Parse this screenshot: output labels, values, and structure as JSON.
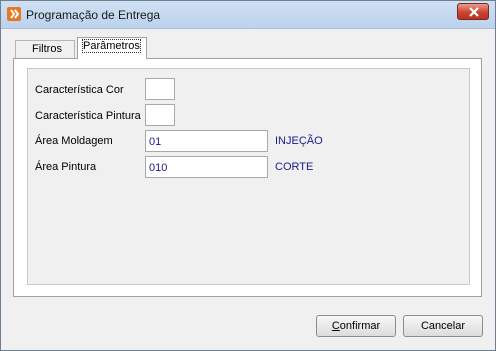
{
  "window": {
    "title": "Programação de Entrega"
  },
  "tabs": [
    {
      "label": "Filtros",
      "active": false
    },
    {
      "label": "Parâmetros",
      "active": true
    }
  ],
  "fields": {
    "caracteristica_cor": {
      "label": "Característica Cor",
      "value": ""
    },
    "caracteristica_pintura": {
      "label": "Característica Pintura",
      "value": ""
    },
    "area_moldagem": {
      "label": "Área Moldagem",
      "value": "01",
      "description": "INJEÇÃO"
    },
    "area_pintura": {
      "label": "Área Pintura",
      "value": "010",
      "description": "CORTE"
    }
  },
  "buttons": {
    "confirmar": {
      "first": "C",
      "rest": "onfirmar"
    },
    "cancelar": {
      "label": "Cancelar"
    }
  },
  "icons": {
    "app": "app-logo-icon",
    "close": "close-icon"
  },
  "colors": {
    "value_text": "#1a1a8c",
    "close_button": "#c94631",
    "titlebar": "#bcd3ec"
  }
}
